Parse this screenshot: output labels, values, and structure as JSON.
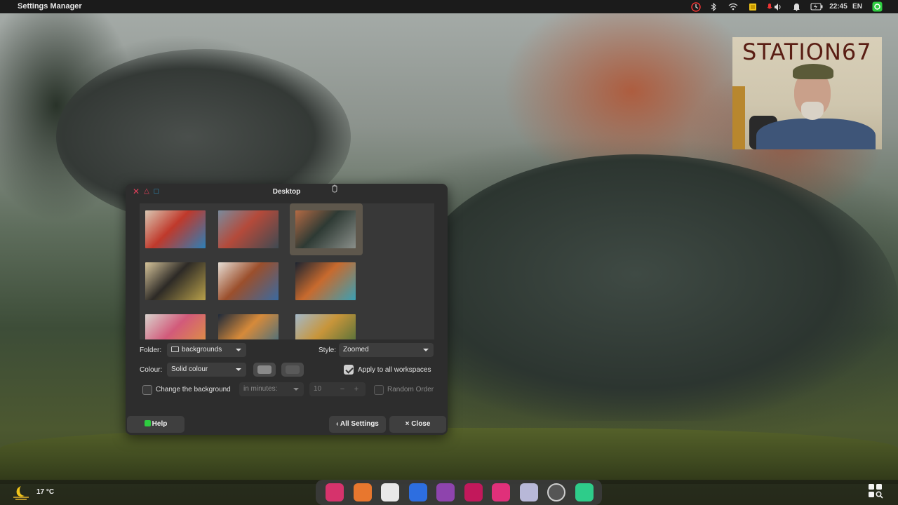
{
  "top_panel": {
    "app_title": "Settings Manager",
    "clock": "22:45",
    "keyboard_layout": "EN"
  },
  "webcam": {
    "overlay_text": "STATION67"
  },
  "window": {
    "title": "Desktop",
    "controls": [
      "close",
      "minimize",
      "maximize"
    ]
  },
  "wallpapers": [
    {
      "name": "colorful-swirls",
      "colors": [
        "#d9c7b3",
        "#c0392b",
        "#2c7fb8"
      ],
      "selected": false
    },
    {
      "name": "dragon-flying",
      "colors": [
        "#7a8a9c",
        "#b44a3a",
        "#3f4a52"
      ],
      "selected": false
    },
    {
      "name": "dragon-landscape",
      "colors": [
        "#b46a44",
        "#2e3a34",
        "#8a8f8a"
      ],
      "selected": true
    },
    {
      "name": "horse-painting",
      "colors": [
        "#d6c49a",
        "#2d2a26",
        "#b8a04a"
      ],
      "selected": false
    },
    {
      "name": "bull-painting",
      "colors": [
        "#e6ded5",
        "#9b4f2c",
        "#3a6aa0"
      ],
      "selected": false
    },
    {
      "name": "elephant-painting",
      "colors": [
        "#1c2430",
        "#c86a2e",
        "#3aa0b5"
      ],
      "selected": false
    },
    {
      "name": "butterfly-painting",
      "colors": [
        "#d8d2cc",
        "#d25a7a",
        "#e09a3a"
      ],
      "selected": false
    },
    {
      "name": "colorful-splash",
      "colors": [
        "#1e2a3a",
        "#d68a3a",
        "#2f6a8a"
      ],
      "selected": false
    },
    {
      "name": "valley-river",
      "colors": [
        "#a3b8c8",
        "#c8953a",
        "#3f6a3a"
      ],
      "selected": false
    }
  ],
  "form": {
    "folder_label": "Folder:",
    "folder_value": "backgrounds",
    "style_label": "Style:",
    "style_value": "Zoomed",
    "colour_label": "Colour:",
    "colour_value": "Solid colour",
    "apply_all_label": "Apply to all workspaces",
    "apply_all_checked": true,
    "change_bg_label": "Change the background",
    "change_bg_checked": false,
    "interval_unit": "in minutes:",
    "interval_value": "10",
    "random_order_label": "Random Order",
    "random_order_checked": false
  },
  "buttons": {
    "help": "Help",
    "all_settings": "All Settings",
    "close": "Close"
  },
  "weather": {
    "temperature": "17 °C"
  },
  "dock_apps": [
    {
      "name": "app-red-icon",
      "color": "#d6336c"
    },
    {
      "name": "app-photos-icon",
      "color": "#e8772e"
    },
    {
      "name": "app-image-viewer-icon",
      "color": "#e8e8e8"
    },
    {
      "name": "app-blue-grid-icon",
      "color": "#2d6ee0"
    },
    {
      "name": "app-sync-icon",
      "color": "#8e44ad"
    },
    {
      "name": "app-download-icon",
      "color": "#c2185b"
    },
    {
      "name": "app-terminal-icon",
      "color": "#e0307a"
    },
    {
      "name": "app-settings-icon",
      "color": "#b8b8d8"
    },
    {
      "name": "app-timeshift-icon",
      "color": "#555555"
    },
    {
      "name": "app-teal-icon",
      "color": "#2ecc8a"
    }
  ]
}
